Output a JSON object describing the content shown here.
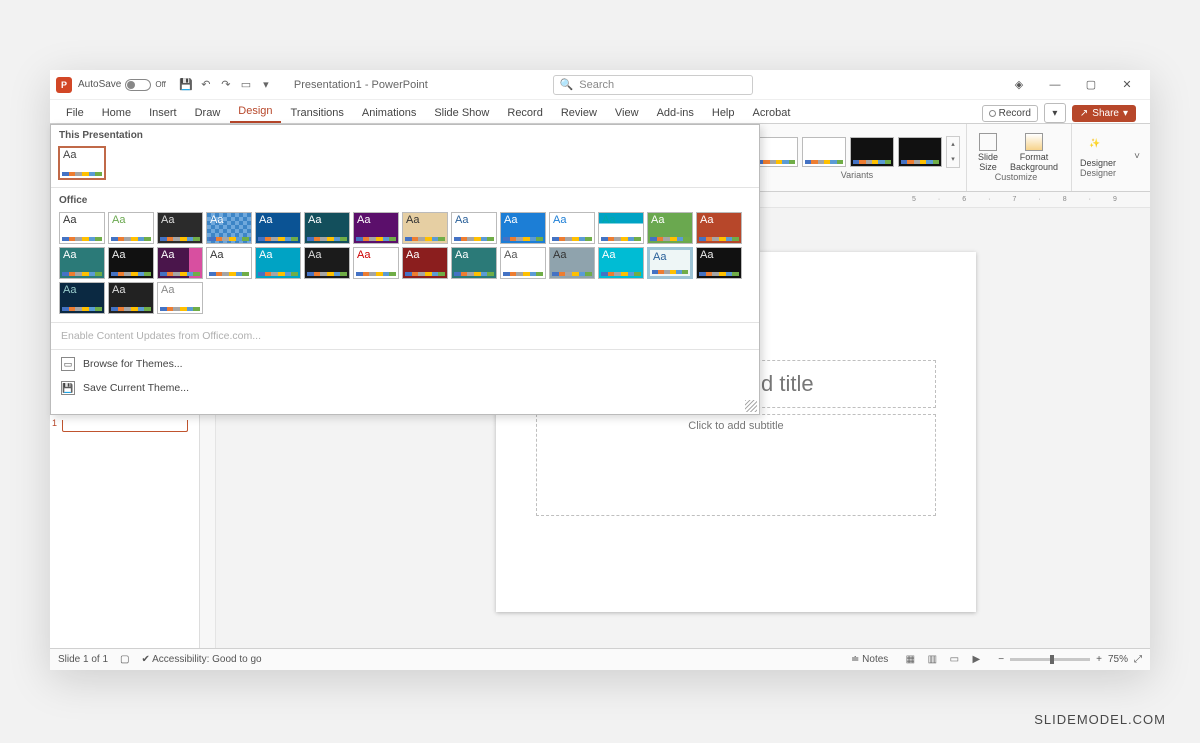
{
  "titlebar": {
    "autosave_label": "AutoSave",
    "autosave_state": "Off",
    "document_title": "Presentation1 - PowerPoint",
    "search_placeholder": "Search"
  },
  "ribbon_tabs": [
    "File",
    "Home",
    "Insert",
    "Draw",
    "Design",
    "Transitions",
    "Animations",
    "Slide Show",
    "Record",
    "Review",
    "View",
    "Add-ins",
    "Help",
    "Acrobat"
  ],
  "ribbon_active_tab": "Design",
  "ribbon_right": {
    "record": "Record",
    "share": "Share"
  },
  "variants_label": "Variants",
  "customize": {
    "slide_size": "Slide Size",
    "format_bg": "Format Background",
    "group_label": "Customize"
  },
  "designer": {
    "button": "Designer",
    "group_label": "Designer"
  },
  "ruler_h": [
    "5",
    "6",
    "7",
    "8",
    "9"
  ],
  "theme_gallery": {
    "section_current": "This Presentation",
    "section_office": "Office",
    "enable_updates": "Enable Content Updates from Office.com...",
    "browse": "Browse for Themes...",
    "save": "Save Current Theme...",
    "current_theme_aa": "Aa",
    "office_themes": [
      {
        "aa": "Aa",
        "bg": "#ffffff",
        "fg": "#333"
      },
      {
        "aa": "Aa",
        "bg": "#ffffff",
        "fg": "#6aa84f"
      },
      {
        "aa": "Aa",
        "bg": "#2b2b2b",
        "fg": "#ddd"
      },
      {
        "aa": "Aa",
        "bg": "#3d85c6",
        "fg": "#fff",
        "pattern": "check"
      },
      {
        "aa": "Aa",
        "bg": "#0b5394",
        "fg": "#fff"
      },
      {
        "aa": "Aa",
        "bg": "#134f5c",
        "fg": "#fff"
      },
      {
        "aa": "Aa",
        "bg": "#5b0f6b",
        "fg": "#fff"
      },
      {
        "aa": "Aa",
        "bg": "#e6cfa3",
        "fg": "#333"
      },
      {
        "aa": "Aa",
        "bg": "#ffffff",
        "fg": "#2a6099",
        "split": "h"
      },
      {
        "aa": "Aa",
        "bg": "#1c7ed6",
        "fg": "#fff"
      },
      {
        "aa": "Aa",
        "bg": "#ffffff",
        "fg": "#1c7ed6"
      },
      {
        "aa": "Aa",
        "bg": "#ffffff",
        "fg": "#0aa",
        "top": "#00a3c4"
      },
      {
        "aa": "Aa",
        "bg": "#6aa84f",
        "fg": "#fff"
      },
      {
        "aa": "Aa",
        "bg": "#b7472a",
        "fg": "#fff"
      },
      {
        "aa": "Aa",
        "bg": "#2b7a78",
        "fg": "#fff"
      },
      {
        "aa": "Aa",
        "bg": "#111",
        "fg": "#eee"
      },
      {
        "aa": "Aa",
        "bg": "#4a154b",
        "fg": "#fff",
        "stripe": "#d84fa0"
      },
      {
        "aa": "Aa",
        "bg": "#ffffff",
        "fg": "#333"
      },
      {
        "aa": "Aa",
        "bg": "#00a3c4",
        "fg": "#fff"
      },
      {
        "aa": "Aa",
        "bg": "#1b1b1b",
        "fg": "#ddd"
      },
      {
        "aa": "Aa",
        "bg": "#ffffff",
        "fg": "#cc0000"
      },
      {
        "aa": "Aa",
        "bg": "#8b1e1e",
        "fg": "#fff"
      },
      {
        "aa": "Aa",
        "bg": "#2b7a78",
        "fg": "#fff"
      },
      {
        "aa": "Aa",
        "bg": "#ffffff",
        "fg": "#555"
      },
      {
        "aa": "Aa",
        "bg": "#8fa3ad",
        "fg": "#333"
      },
      {
        "aa": "Aa",
        "bg": "#00bcd4",
        "fg": "#fff"
      },
      {
        "aa": "Aa",
        "bg": "#eef6f6",
        "fg": "#2a6099",
        "frame": true
      },
      {
        "aa": "Aa",
        "bg": "#111",
        "fg": "#eee"
      },
      {
        "aa": "Aa",
        "bg": "#0b2942",
        "fg": "#9cc"
      },
      {
        "aa": "Aa",
        "bg": "#222",
        "fg": "#ddd"
      },
      {
        "aa": "Aa",
        "bg": "#ffffff",
        "fg": "#888"
      }
    ]
  },
  "slide": {
    "title_placeholder": "Click to add title",
    "subtitle_placeholder": "Click to add subtitle"
  },
  "statusbar": {
    "slide_of": "Slide 1 of 1",
    "accessibility": "Accessibility: Good to go",
    "notes": "Notes",
    "zoom_pct": "75%"
  },
  "watermark": "SLIDEMODEL.COM"
}
